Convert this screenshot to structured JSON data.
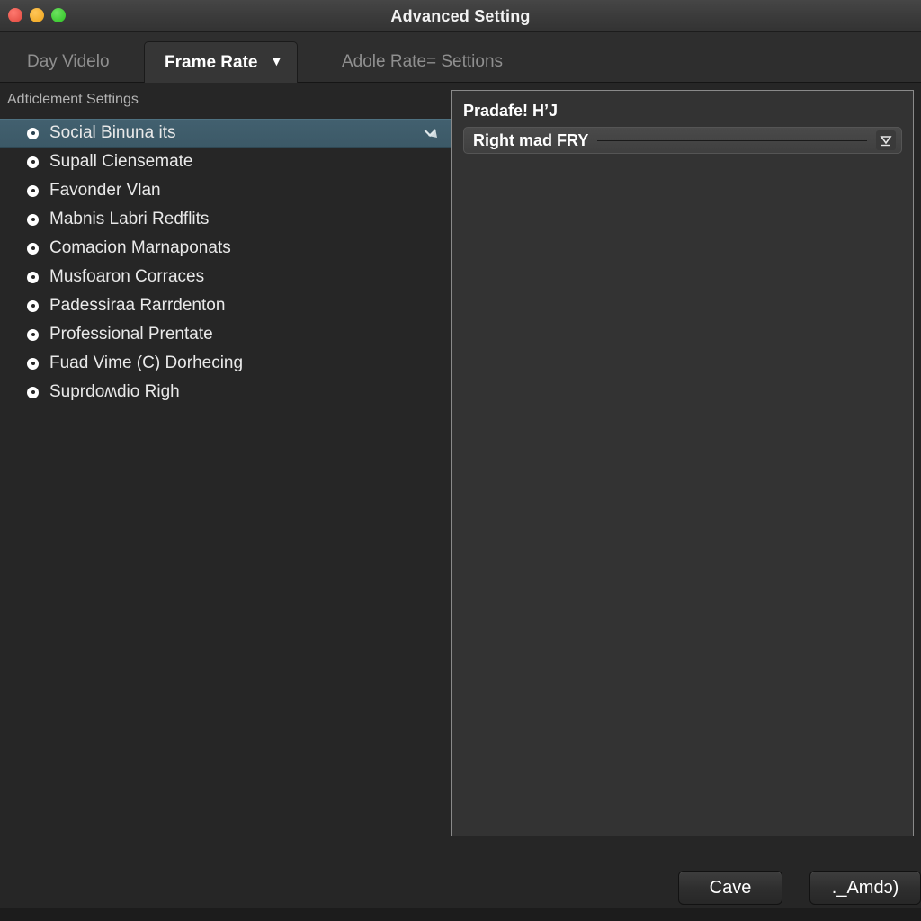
{
  "window": {
    "title": "Advanced Setting",
    "traffic_lights": [
      "close-button",
      "minimize-button",
      "maximize-button"
    ]
  },
  "tabs": [
    {
      "label": "Day Videlo",
      "active": false
    },
    {
      "label": "Frame Rate",
      "active": true,
      "caret": "▼"
    },
    {
      "label": "Adole Rate= Settions",
      "active": false
    }
  ],
  "sidebar": {
    "header": "Adticlement Settings",
    "items": [
      {
        "label": "Social Binuna its",
        "selected": true,
        "action_icon": "arrow-enter-icon"
      },
      {
        "label": "Supall Ciensemate",
        "selected": false
      },
      {
        "label": "Favonder Vlan",
        "selected": false
      },
      {
        "label": "Mabnis Labri Redflits",
        "selected": false
      },
      {
        "label": "Comacion Marnaponats",
        "selected": false
      },
      {
        "label": "Musfoaron Corraces",
        "selected": false
      },
      {
        "label": "Padessiraa Rarrdenton",
        "selected": false
      },
      {
        "label": "Professional Prentate",
        "selected": false
      },
      {
        "label": "Fuad Vime (C) Dorhecing",
        "selected": false
      },
      {
        "label": "Suprdoʍdio Righ",
        "selected": false
      }
    ]
  },
  "panel": {
    "label": "Pradafe! H’J",
    "dropdown": {
      "value": "Right mad FRY",
      "caret_icon": "chevron-down-icon"
    }
  },
  "footer": {
    "save_label": "Cave",
    "cancel_label": "._Amdɔ)"
  },
  "colors": {
    "window_bg": "#262626",
    "titlebar_bg": "#3b3b3b",
    "tab_active_bg": "#363636",
    "selection": "#3f5d6b",
    "panel_bg": "#333333",
    "panel_border": "#8a8a8a",
    "text_primary": "#e9e9e9",
    "text_muted": "#8f8f8f",
    "close_light": "#e8554b",
    "minimize_light": "#f3ad2c",
    "maximize_light": "#3fcb34"
  }
}
